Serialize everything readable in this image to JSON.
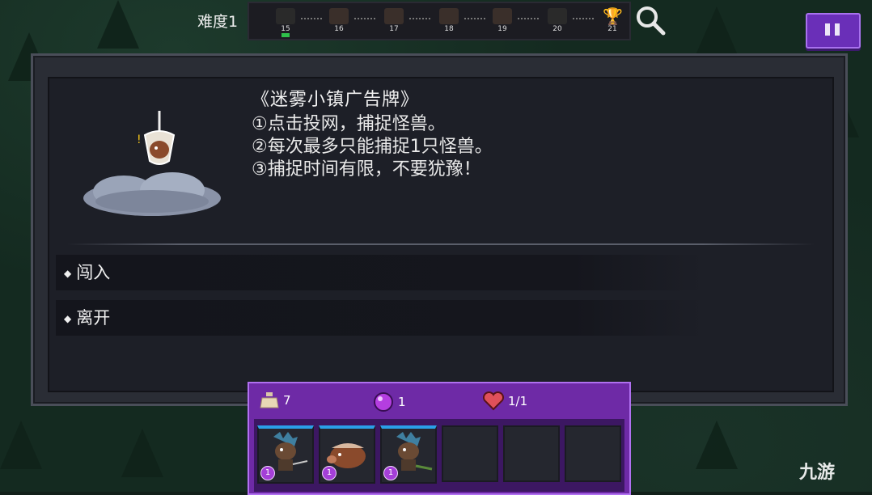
{
  "top_bar": {
    "difficulty": "难度1",
    "stages": [
      {
        "num": "15",
        "kind": "boss",
        "current": true
      },
      {
        "num": "16",
        "kind": "battle"
      },
      {
        "num": "17",
        "kind": "battle"
      },
      {
        "num": "18",
        "kind": "battle"
      },
      {
        "num": "19",
        "kind": "battle"
      },
      {
        "num": "20",
        "kind": "boss"
      },
      {
        "num": "21",
        "kind": "trophy"
      }
    ]
  },
  "event": {
    "title": "《迷雾小镇广告牌》",
    "lines": [
      "①点击投网，捕捉怪兽。",
      "②每次最多只能捕捉1只怪兽。",
      "③捕捉时间有限，不要犹豫！"
    ],
    "options": [
      "闯入",
      "离开"
    ]
  },
  "resources": {
    "potion": "7",
    "orb": "1",
    "hp": "1/1"
  },
  "team": {
    "slots": [
      {
        "filled": true,
        "level": "1",
        "icon": "boar-warrior-icon"
      },
      {
        "filled": true,
        "level": "1",
        "icon": "boar-icon"
      },
      {
        "filled": true,
        "level": "1",
        "icon": "boar-warrior-icon"
      },
      {
        "filled": false
      },
      {
        "filled": false
      },
      {
        "filled": false
      }
    ]
  },
  "watermark": "九游",
  "colors": {
    "accent_purple": "#6e2aa6",
    "current_stage": "#2ec04a",
    "slot_top": "#2aa0e8"
  }
}
